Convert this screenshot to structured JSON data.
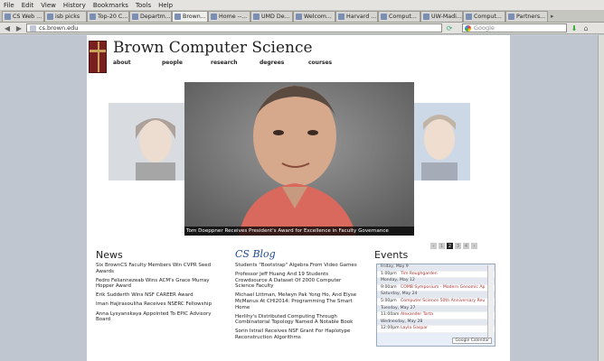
{
  "menu": [
    "File",
    "Edit",
    "View",
    "History",
    "Bookmarks",
    "Tools",
    "Help"
  ],
  "tabs": [
    {
      "label": "CS Web ...",
      "active": false
    },
    {
      "label": "isb picks",
      "active": false
    },
    {
      "label": "Top-20 C...",
      "active": false
    },
    {
      "label": "Departm...",
      "active": false
    },
    {
      "label": "Brown...",
      "active": true
    },
    {
      "label": "Home --...",
      "active": false
    },
    {
      "label": "UMD De...",
      "active": false
    },
    {
      "label": "Welcom...",
      "active": false
    },
    {
      "label": "Harvard ...",
      "active": false
    },
    {
      "label": "Comput...",
      "active": false
    },
    {
      "label": "UW-Madi...",
      "active": false
    },
    {
      "label": "Comput...",
      "active": false
    },
    {
      "label": "Partners...",
      "active": false
    }
  ],
  "address": "cs.brown.edu",
  "search_placeholder": "Google",
  "site": {
    "title": "Brown Computer Science",
    "nav": [
      "about",
      "people",
      "research",
      "degrees",
      "courses"
    ]
  },
  "hero": {
    "caption": "Tom Doeppner Receives President's Award for Excellence in Faculty Governance",
    "pager": [
      "‹",
      "1",
      "2",
      "3",
      "4",
      "›"
    ],
    "active_page": "2"
  },
  "news": {
    "heading": "News",
    "items": [
      "Six BrownCS Faculty Members Win CVPR Seed Awards",
      "Fedro Feliannezeab Wins ACM's Grace Murray Hopper Award",
      "Erik Sudderth Wins NSF CAREER Award",
      "Iman Hajirasouliha Receives NSERC Fellowship",
      "Anna Lysyanskaya Appointed To EPIC Advisory Board"
    ]
  },
  "blog": {
    "heading": "CS Blog",
    "items": [
      "Students \"Bootstrap\" Algebra From Video Games",
      "Professor Jeff Huang And 19 Students Crowdsource A Dataset Of 2000 Computer Science Faculty",
      "Michael Littman, Melwyn Pak Yong Ho, And Elyse McManus At CHI2014: Programming The Smart Home",
      "Herlihy's Distributed Computing Through Combinatorial Topology Named A Notable Book",
      "Sorin Istrail Receives NSF Grant For Haplotype Reconstruction Algorithms"
    ]
  },
  "events": {
    "heading": "Events",
    "rows": [
      {
        "kind": "day",
        "text": "Friday, May 9"
      },
      {
        "kind": "ev",
        "time": "1:00pm",
        "text": "Tim Roughgarden"
      },
      {
        "kind": "day",
        "text": "Monday, May 12"
      },
      {
        "kind": "ev",
        "time": "9:00am",
        "text": "COMB Symposium - Modern Genomic Ap"
      },
      {
        "kind": "day",
        "text": "Saturday, May 24"
      },
      {
        "kind": "ev",
        "time": "5:00pm",
        "text": "Computer Science 50th Anniversary Reu"
      },
      {
        "kind": "day",
        "text": "Tuesday, May 27"
      },
      {
        "kind": "ev",
        "time": "11:00am",
        "text": "Alexander Tarta"
      },
      {
        "kind": "day",
        "text": "Wednesday, May 28"
      },
      {
        "kind": "ev",
        "time": "12:00pm",
        "text": "Layla Gaspar"
      }
    ],
    "gcal_label": "Google Calendar"
  }
}
